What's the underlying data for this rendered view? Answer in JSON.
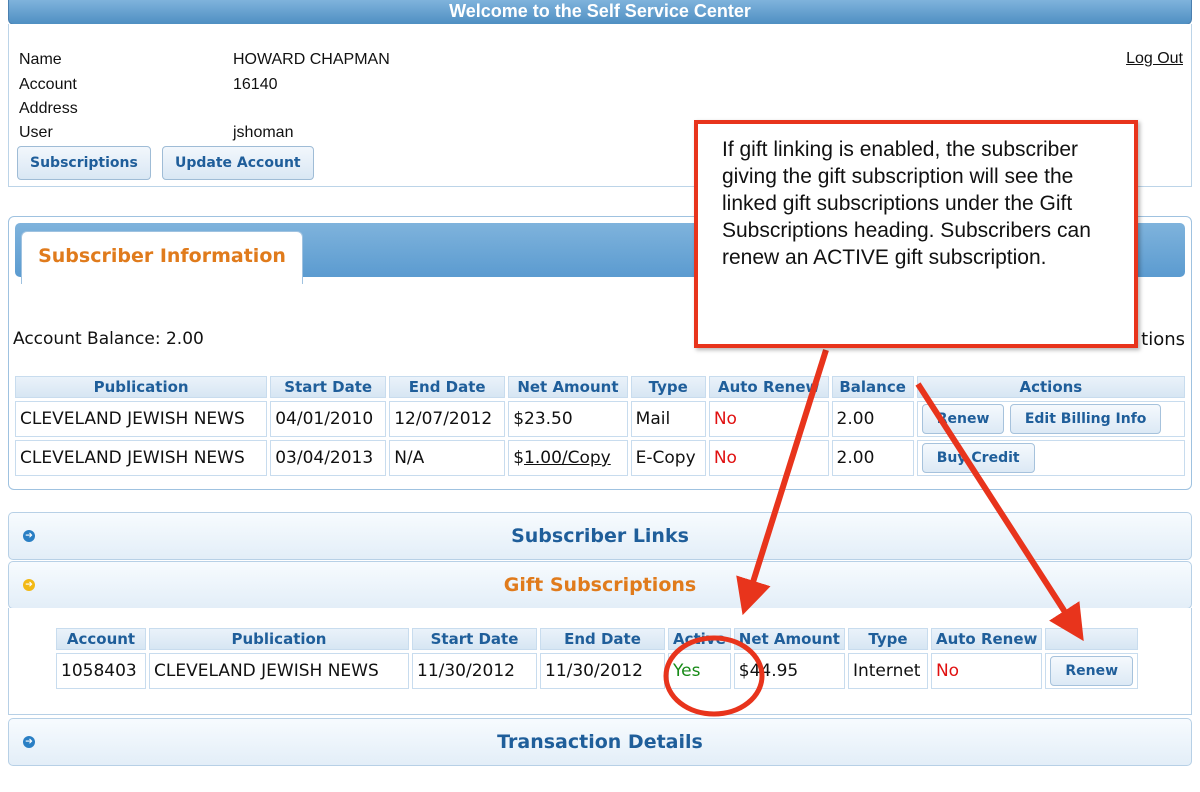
{
  "banner": {
    "title": "Welcome to the Self Service Center"
  },
  "account_info": {
    "name_label": "Name",
    "name_value": "HOWARD CHAPMAN",
    "account_label": "Account",
    "account_value": "16140",
    "address_label": "Address",
    "address_value": "",
    "user_label": "User",
    "user_value": "jshoman",
    "logout": "Log Out",
    "buttons": {
      "subscriptions": "Subscriptions",
      "update_account": "Update Account"
    }
  },
  "subscriber_info": {
    "tab_label": "Subscriber Information",
    "balance_text": "Account Balance: 2.00",
    "right_link_fragment": "tions",
    "headers": [
      "Publication",
      "Start Date",
      "End Date",
      "Net Amount",
      "Type",
      "Auto Renew",
      "Balance",
      "Actions"
    ],
    "rows": [
      {
        "publication": "CLEVELAND JEWISH NEWS",
        "start": "04/01/2010",
        "end": "12/07/2012",
        "net_amount": "$23.50",
        "type": "Mail",
        "auto_renew": "No",
        "balance": "2.00",
        "actions": [
          "Renew",
          "Edit Billing Info"
        ]
      },
      {
        "publication": "CLEVELAND JEWISH NEWS",
        "start": "03/04/2013",
        "end": "N/A",
        "net_amount_prefix": "$",
        "net_amount_link": "1.00/Copy",
        "type": "E-Copy",
        "auto_renew": "No",
        "balance": "2.00",
        "actions": [
          "Buy Credit"
        ]
      }
    ]
  },
  "sections": {
    "subscriber_links": "Subscriber Links",
    "gift_subscriptions": "Gift Subscriptions",
    "transaction_details": "Transaction Details"
  },
  "gift_table": {
    "headers": [
      "Account",
      "Publication",
      "Start Date",
      "End Date",
      "Active",
      "Net Amount",
      "Type",
      "Auto Renew",
      ""
    ],
    "rows": [
      {
        "account": "1058403",
        "publication": "CLEVELAND JEWISH NEWS",
        "start": "11/30/2012",
        "end": "11/30/2012",
        "active": "Yes",
        "net_amount": "$44.95",
        "type": "Internet",
        "auto_renew": "No",
        "action": "Renew"
      }
    ]
  },
  "callout": {
    "text": "If gift linking is enabled, the subscriber giving the gift subscription will see the linked gift subscriptions under the Gift Subscriptions heading.  Subscribers can renew an ACTIVE gift subscription."
  },
  "colors": {
    "accent_orange": "#e07b1c",
    "link_blue": "#1f5e9a",
    "annotation_red": "#e8341c",
    "no_red": "#e01010",
    "yes_green": "#178a17"
  }
}
